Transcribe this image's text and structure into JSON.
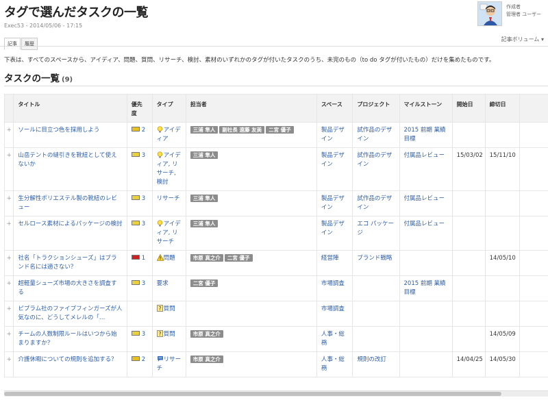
{
  "page": {
    "title": "タグで選んだタスクの一覧",
    "meta": "Exec53 - 2014/05/06 - 17:15"
  },
  "author": {
    "role": "作成者",
    "name": "管理者 ユーザー"
  },
  "tabs": [
    {
      "label": "記事",
      "active": true
    },
    {
      "label": "履歴",
      "active": false
    }
  ],
  "volume_label": "記事ボリューム ▾",
  "description": "下表は、すべてのスペースから、アイディア、問題、質問、リサーチ、検討、素材のいずれかのタグが付いたタスクのうち、未完のもの（to do タグが付いたもの）だけを集めたものです。",
  "section": {
    "title": "タスクの一覧",
    "count": "(9)"
  },
  "table": {
    "headers": {
      "title": "タイトル",
      "priority": "優先度",
      "type": "タイプ",
      "assignee": "担当者",
      "space": "スペース",
      "project": "プロジェクト",
      "milestone": "マイルストーン",
      "start": "開始日",
      "due": "締切日"
    },
    "rows": [
      {
        "title": "ソールに目立つ色を採用しよう",
        "priority": "2",
        "priority_color": "#e8c020",
        "type_icon": "lightbulb-icon",
        "type": "アイディア",
        "assignees": [
          "三浦 隼人",
          "副社長 遠藤 友美",
          "二宮 優子"
        ],
        "space": "製品デザイン",
        "project": "試作品のデザイン",
        "milestone": "2015 前期 業績目標",
        "start": "",
        "due": ""
      },
      {
        "title": "山岳テントの縫引きを靴紐として使えないか",
        "priority": "3",
        "priority_color": "#e8d040",
        "type_icon": "lightbulb-icon",
        "type": "アイディア, リサーチ, 検討",
        "assignees": [
          "三浦 隼人"
        ],
        "space": "製品デザイン",
        "project": "試作品のデザイン",
        "milestone": "付属品レビュー",
        "start": "15/03/02",
        "due": "15/11/10"
      },
      {
        "title": "生分解性ポリエステル製の靴紐のレビュー",
        "priority": "3",
        "priority_color": "#e8d040",
        "type_icon": "",
        "type": "リサーチ",
        "assignees": [
          "三浦 隼人"
        ],
        "space": "製品デザイン",
        "project": "試作品のデザイン",
        "milestone": "付属品レビュー",
        "start": "",
        "due": ""
      },
      {
        "title": "セルロース素材によるパッケージの検討",
        "priority": "3",
        "priority_color": "#e8d040",
        "type_icon": "lightbulb-icon",
        "type": "アイディア, リサーチ",
        "assignees": [
          "三浦 隼人"
        ],
        "space": "製品デザイン",
        "project": "エコ パッケージ",
        "milestone": "付属品レビュー",
        "start": "",
        "due": ""
      },
      {
        "title": "社名「トラクションシューズ」はブランド名には適さない？",
        "priority": "1",
        "priority_color": "#cc2222",
        "type_icon": "warning-icon",
        "type": "問題",
        "assignees": [
          "市原 真之介",
          "二宮 優子"
        ],
        "space": "経営陣",
        "project": "ブランド戦略",
        "milestone": "",
        "start": "",
        "due": "14/05/10"
      },
      {
        "title": "超軽量シューズ市場の大きさを調査する",
        "priority": "3",
        "priority_color": "#e8d040",
        "type_icon": "",
        "type": "要求",
        "assignees": [
          "二宮 優子"
        ],
        "space": "市場調査",
        "project": "",
        "milestone": "2015 前期 業績目標",
        "start": "",
        "due": ""
      },
      {
        "title": "ピプラム社のファイブフィンガーズが人気なのに、どうしてメレルの「…",
        "priority": "",
        "priority_color": "",
        "type_icon": "question-icon",
        "type": "質問",
        "assignees": [],
        "space": "市場調査",
        "project": "",
        "milestone": "",
        "start": "",
        "due": ""
      },
      {
        "title": "チームの人数制限ルールはいつから始まりますか？",
        "priority": "3",
        "priority_color": "#e8d040",
        "type_icon": "question-icon",
        "type": "質問",
        "assignees": [
          "市原 真之介"
        ],
        "space": "人事・総務",
        "project": "",
        "milestone": "",
        "start": "",
        "due": "14/05/09"
      },
      {
        "title": "介護休暇についての規則を追加する？",
        "priority": "2",
        "priority_color": "#e8c020",
        "type_icon": "chat-icon",
        "type": "リサーチ",
        "assignees": [
          "市原 真之介"
        ],
        "space": "人事・総務",
        "project": "規則の改訂",
        "milestone": "",
        "start": "14/04/25",
        "due": "14/05/30"
      }
    ]
  },
  "expand_glyph": "+",
  "colors": {
    "link": "#2b5da8",
    "tag_bg": "#8c8c8c",
    "header_bg": "#f2f2f2"
  }
}
